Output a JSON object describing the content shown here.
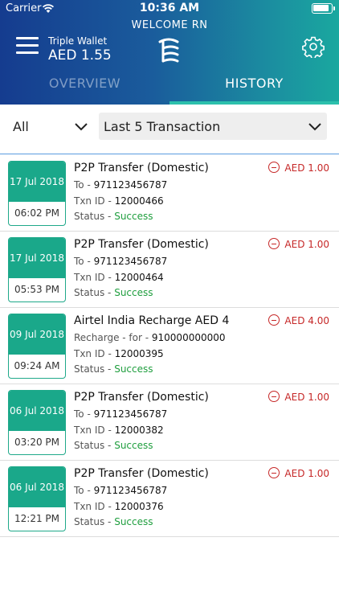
{
  "status_bar": {
    "carrier": "Carrier",
    "time": "10:36 AM"
  },
  "header": {
    "welcome": "WELCOME  RN",
    "wallet_name": "Triple Wallet",
    "balance": "AED 1.55"
  },
  "tabs": [
    {
      "label": "OVERVIEW",
      "active": false
    },
    {
      "label": "HISTORY",
      "active": true
    }
  ],
  "filters": {
    "type": "All",
    "period": "Last 5 Transaction"
  },
  "colors": {
    "accent": "#1aa88a",
    "debit": "#c62828",
    "success": "#1f9e3e",
    "header_start": "#153c8f",
    "header_end": "#1aa89f"
  },
  "transactions": [
    {
      "date": "17 Jul 2018",
      "time": "06:02 PM",
      "title": "P2P Transfer (Domestic)",
      "party_label": "To - ",
      "party_value": "971123456787",
      "txn_label": "Txn ID - ",
      "txn_id": "12000466",
      "status_label": "Status - ",
      "status": "Success",
      "amount": "AED 1.00"
    },
    {
      "date": "17 Jul 2018",
      "time": "05:53 PM",
      "title": "P2P Transfer (Domestic)",
      "party_label": "To - ",
      "party_value": "971123456787",
      "txn_label": "Txn ID - ",
      "txn_id": "12000464",
      "status_label": "Status - ",
      "status": "Success",
      "amount": "AED 1.00"
    },
    {
      "date": "09 Jul 2018",
      "time": "09:24 AM",
      "title": "Airtel India Recharge AED 4",
      "party_label": "Recharge - for - ",
      "party_value": "910000000000",
      "txn_label": "Txn ID - ",
      "txn_id": "12000395",
      "status_label": "Status - ",
      "status": "Success",
      "amount": "AED 4.00"
    },
    {
      "date": "06 Jul 2018",
      "time": "03:20 PM",
      "title": "P2P Transfer (Domestic)",
      "party_label": "To - ",
      "party_value": "971123456787",
      "txn_label": "Txn ID - ",
      "txn_id": "12000382",
      "status_label": "Status - ",
      "status": "Success",
      "amount": "AED 1.00"
    },
    {
      "date": "06 Jul 2018",
      "time": "12:21 PM",
      "title": "P2P Transfer (Domestic)",
      "party_label": "To - ",
      "party_value": "971123456787",
      "txn_label": "Txn ID - ",
      "txn_id": "12000376",
      "status_label": "Status - ",
      "status": "Success",
      "amount": "AED 1.00"
    }
  ]
}
